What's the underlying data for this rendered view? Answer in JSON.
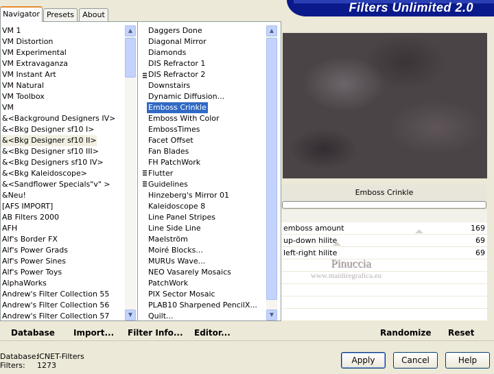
{
  "tabs": [
    "Navigator",
    "Presets",
    "About"
  ],
  "banner_title": "Filters Unlimited 2.0",
  "categories": [
    "VM 1",
    "VM Distortion",
    "VM Experimental",
    "VM Extravaganza",
    "VM Instant Art",
    "VM Natural",
    "VM Toolbox",
    "VM",
    "&<Background Designers IV>",
    "&<Bkg Designer sf10 I>",
    "&<Bkg Designer sf10 II>",
    "&<Bkg Designer sf10 III>",
    "&<Bkg Designers sf10 IV>",
    "&<Bkg Kaleidoscope>",
    "&<Sandflower Specials\"v\" >",
    "&Neu!",
    "[AFS IMPORT]",
    "AB Filters 2000",
    "AFH",
    "Alf's Border FX",
    "Alf's Power Grads",
    "Alf's Power Sines",
    "Alf's Power Toys",
    "AlphaWorks",
    "Andrew's Filter Collection 55",
    "Andrew's Filter Collection 56",
    "Andrew's Filter Collection 57"
  ],
  "categories_selected_index": 10,
  "filters": [
    "Daggers Done",
    "Diagonal Mirror",
    "Diamonds",
    "DIS Refractor 1",
    "DIS Refractor 2",
    "Downstairs",
    "Dynamic Diffusion...",
    "Emboss Crinkle",
    "Emboss With Color",
    "EmbossTimes",
    "Facet Offset",
    "Fan Blades",
    "FH PatchWork",
    "Flutter",
    "Guidelines",
    "Hinzeberg's Mirror 01",
    "Kaleidoscope 8",
    "Line Panel Stripes",
    "Line Side Line",
    "Maelström",
    "Moiré Blocks...",
    "MURUs Wave...",
    "NEO Vasarely Mosaics",
    "PatchWork",
    "PIX Sector Mosaic",
    "PLAB10 Sharpened PencilX...",
    "Quilt..."
  ],
  "filters_selected_index": 7,
  "filter_name": "Emboss Crinkle",
  "parameters": [
    {
      "label": "emboss amount",
      "value": "169"
    },
    {
      "label": "up-down hilite",
      "value": "69"
    },
    {
      "label": "left-right hilite",
      "value": "69"
    }
  ],
  "watermark_name": "Pinuccia",
  "watermark_url": "www.maidiregrafica.eu",
  "toolbar": {
    "database": "Database",
    "import": "Import...",
    "filter_info": "Filter Info...",
    "editor": "Editor...",
    "randomize": "Randomize",
    "reset": "Reset"
  },
  "status": {
    "database_label": "Database:",
    "database_value": "ICNET-Filters",
    "filters_label": "Filters:",
    "filters_value": "1273"
  },
  "buttons": {
    "apply": "Apply",
    "cancel": "Cancel",
    "help": "Help"
  }
}
